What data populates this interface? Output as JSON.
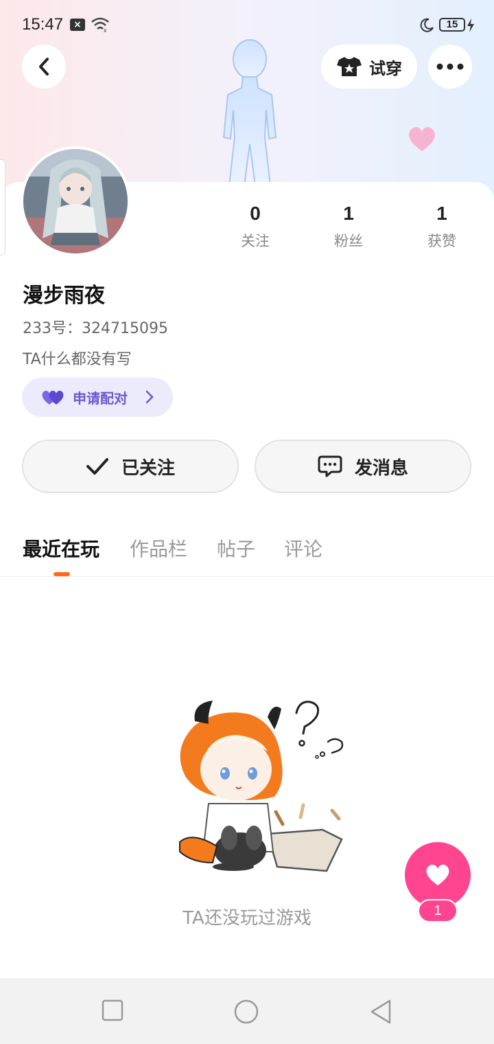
{
  "status_bar": {
    "time": "15:47",
    "notification_icon": "x-box-icon",
    "wifi_icon": "wifi-icon",
    "moon_icon": "moon-icon",
    "battery": "15",
    "charging_icon": "bolt-icon"
  },
  "top_bar": {
    "back_icon": "chevron-left-icon",
    "try_on_label": "试穿",
    "try_on_icon": "tshirt-icon",
    "more_icon": "more-dots-icon"
  },
  "profile": {
    "username": "漫步雨夜",
    "user_id": "233号：324715095",
    "bio": "TA什么都没有写",
    "pair_button": "申请配对"
  },
  "stats": [
    {
      "value": "0",
      "label": "关注"
    },
    {
      "value": "1",
      "label": "粉丝"
    },
    {
      "value": "1",
      "label": "获赞"
    }
  ],
  "actions": {
    "follow_label": "已关注",
    "message_label": "发消息"
  },
  "tabs": [
    {
      "label": "最近在玩",
      "active": true
    },
    {
      "label": "作品栏",
      "active": false
    },
    {
      "label": "帖子",
      "active": false
    },
    {
      "label": "评论",
      "active": false
    }
  ],
  "empty_state": {
    "text": "TA还没玩过游戏"
  },
  "like_fab": {
    "count": "1"
  },
  "colors": {
    "accent_orange": "#ff6a1a",
    "pair_purple": "#6b58d6",
    "like_pink": "#ff4590"
  }
}
